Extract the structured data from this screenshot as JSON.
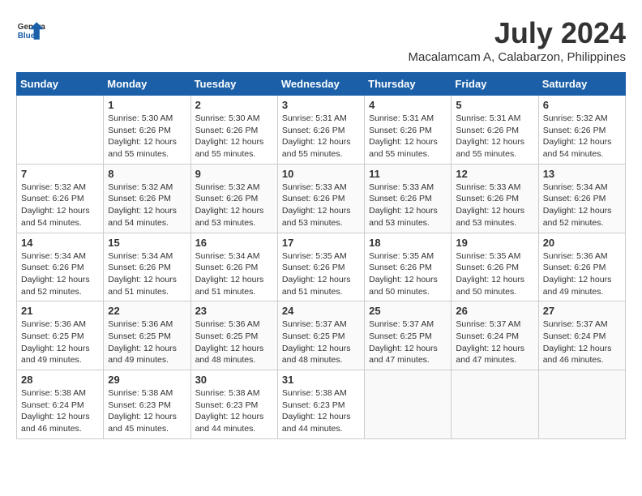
{
  "header": {
    "logo": "GeneralBlue",
    "month": "July 2024",
    "location": "Macalamcam A, Calabarzon, Philippines"
  },
  "weekdays": [
    "Sunday",
    "Monday",
    "Tuesday",
    "Wednesday",
    "Thursday",
    "Friday",
    "Saturday"
  ],
  "weeks": [
    [
      {
        "day": "",
        "info": ""
      },
      {
        "day": "1",
        "info": "Sunrise: 5:30 AM\nSunset: 6:26 PM\nDaylight: 12 hours\nand 55 minutes."
      },
      {
        "day": "2",
        "info": "Sunrise: 5:30 AM\nSunset: 6:26 PM\nDaylight: 12 hours\nand 55 minutes."
      },
      {
        "day": "3",
        "info": "Sunrise: 5:31 AM\nSunset: 6:26 PM\nDaylight: 12 hours\nand 55 minutes."
      },
      {
        "day": "4",
        "info": "Sunrise: 5:31 AM\nSunset: 6:26 PM\nDaylight: 12 hours\nand 55 minutes."
      },
      {
        "day": "5",
        "info": "Sunrise: 5:31 AM\nSunset: 6:26 PM\nDaylight: 12 hours\nand 55 minutes."
      },
      {
        "day": "6",
        "info": "Sunrise: 5:32 AM\nSunset: 6:26 PM\nDaylight: 12 hours\nand 54 minutes."
      }
    ],
    [
      {
        "day": "7",
        "info": "Sunrise: 5:32 AM\nSunset: 6:26 PM\nDaylight: 12 hours\nand 54 minutes."
      },
      {
        "day": "8",
        "info": "Sunrise: 5:32 AM\nSunset: 6:26 PM\nDaylight: 12 hours\nand 54 minutes."
      },
      {
        "day": "9",
        "info": "Sunrise: 5:32 AM\nSunset: 6:26 PM\nDaylight: 12 hours\nand 53 minutes."
      },
      {
        "day": "10",
        "info": "Sunrise: 5:33 AM\nSunset: 6:26 PM\nDaylight: 12 hours\nand 53 minutes."
      },
      {
        "day": "11",
        "info": "Sunrise: 5:33 AM\nSunset: 6:26 PM\nDaylight: 12 hours\nand 53 minutes."
      },
      {
        "day": "12",
        "info": "Sunrise: 5:33 AM\nSunset: 6:26 PM\nDaylight: 12 hours\nand 53 minutes."
      },
      {
        "day": "13",
        "info": "Sunrise: 5:34 AM\nSunset: 6:26 PM\nDaylight: 12 hours\nand 52 minutes."
      }
    ],
    [
      {
        "day": "14",
        "info": "Sunrise: 5:34 AM\nSunset: 6:26 PM\nDaylight: 12 hours\nand 52 minutes."
      },
      {
        "day": "15",
        "info": "Sunrise: 5:34 AM\nSunset: 6:26 PM\nDaylight: 12 hours\nand 51 minutes."
      },
      {
        "day": "16",
        "info": "Sunrise: 5:34 AM\nSunset: 6:26 PM\nDaylight: 12 hours\nand 51 minutes."
      },
      {
        "day": "17",
        "info": "Sunrise: 5:35 AM\nSunset: 6:26 PM\nDaylight: 12 hours\nand 51 minutes."
      },
      {
        "day": "18",
        "info": "Sunrise: 5:35 AM\nSunset: 6:26 PM\nDaylight: 12 hours\nand 50 minutes."
      },
      {
        "day": "19",
        "info": "Sunrise: 5:35 AM\nSunset: 6:26 PM\nDaylight: 12 hours\nand 50 minutes."
      },
      {
        "day": "20",
        "info": "Sunrise: 5:36 AM\nSunset: 6:26 PM\nDaylight: 12 hours\nand 49 minutes."
      }
    ],
    [
      {
        "day": "21",
        "info": "Sunrise: 5:36 AM\nSunset: 6:25 PM\nDaylight: 12 hours\nand 49 minutes."
      },
      {
        "day": "22",
        "info": "Sunrise: 5:36 AM\nSunset: 6:25 PM\nDaylight: 12 hours\nand 49 minutes."
      },
      {
        "day": "23",
        "info": "Sunrise: 5:36 AM\nSunset: 6:25 PM\nDaylight: 12 hours\nand 48 minutes."
      },
      {
        "day": "24",
        "info": "Sunrise: 5:37 AM\nSunset: 6:25 PM\nDaylight: 12 hours\nand 48 minutes."
      },
      {
        "day": "25",
        "info": "Sunrise: 5:37 AM\nSunset: 6:25 PM\nDaylight: 12 hours\nand 47 minutes."
      },
      {
        "day": "26",
        "info": "Sunrise: 5:37 AM\nSunset: 6:24 PM\nDaylight: 12 hours\nand 47 minutes."
      },
      {
        "day": "27",
        "info": "Sunrise: 5:37 AM\nSunset: 6:24 PM\nDaylight: 12 hours\nand 46 minutes."
      }
    ],
    [
      {
        "day": "28",
        "info": "Sunrise: 5:38 AM\nSunset: 6:24 PM\nDaylight: 12 hours\nand 46 minutes."
      },
      {
        "day": "29",
        "info": "Sunrise: 5:38 AM\nSunset: 6:23 PM\nDaylight: 12 hours\nand 45 minutes."
      },
      {
        "day": "30",
        "info": "Sunrise: 5:38 AM\nSunset: 6:23 PM\nDaylight: 12 hours\nand 44 minutes."
      },
      {
        "day": "31",
        "info": "Sunrise: 5:38 AM\nSunset: 6:23 PM\nDaylight: 12 hours\nand 44 minutes."
      },
      {
        "day": "",
        "info": ""
      },
      {
        "day": "",
        "info": ""
      },
      {
        "day": "",
        "info": ""
      }
    ]
  ]
}
